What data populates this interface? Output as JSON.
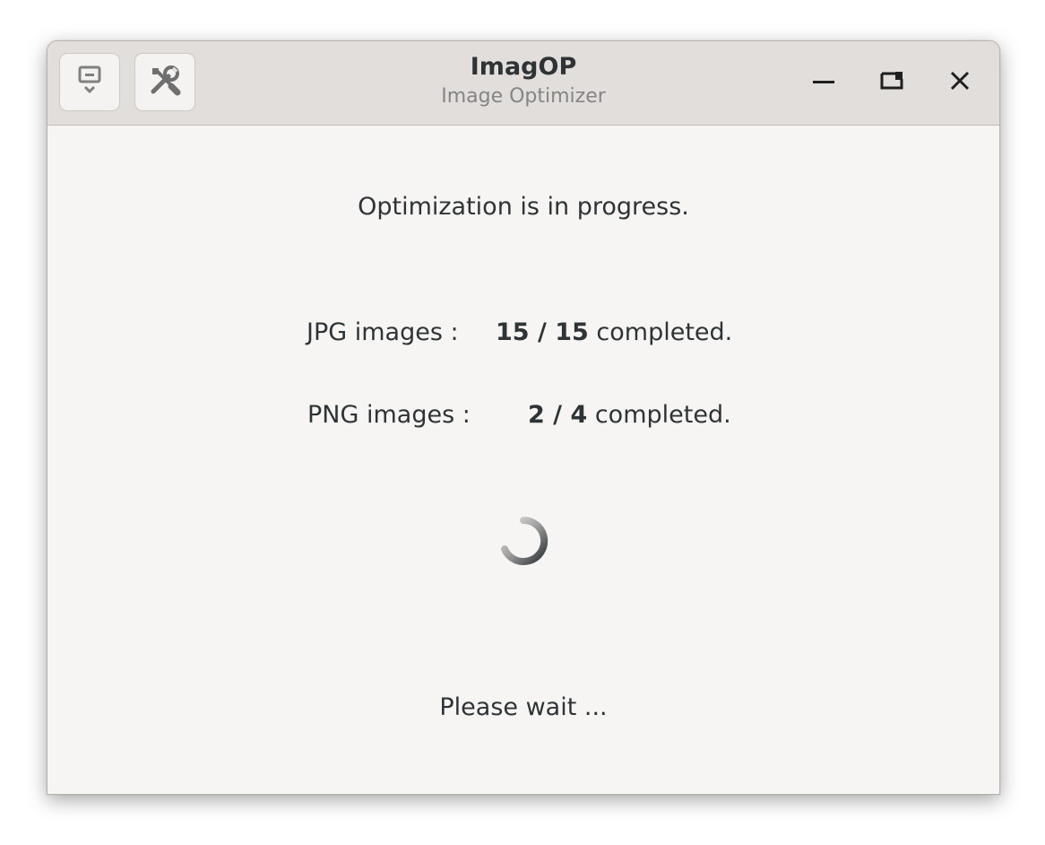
{
  "window": {
    "title": "ImagOP",
    "subtitle": "Image Optimizer"
  },
  "toolbar": {
    "menu_icon": "download-menu-icon",
    "tools_icon": "tools-icon"
  },
  "window_controls": {
    "minimize_icon": "minimize-icon",
    "maximize_icon": "maximize-icon",
    "close_icon": "close-icon"
  },
  "main": {
    "status": "Optimization is in progress.",
    "jpg": {
      "label": "JPG images :",
      "progress": "15 / 15",
      "suffix": "completed."
    },
    "png": {
      "label": "PNG images :",
      "progress": "2 / 4",
      "suffix": "completed."
    },
    "wait": "Please wait ..."
  },
  "colors": {
    "headerbar": "#e1dedb",
    "window_bg": "#f6f5f4",
    "text": "#2e3436"
  }
}
